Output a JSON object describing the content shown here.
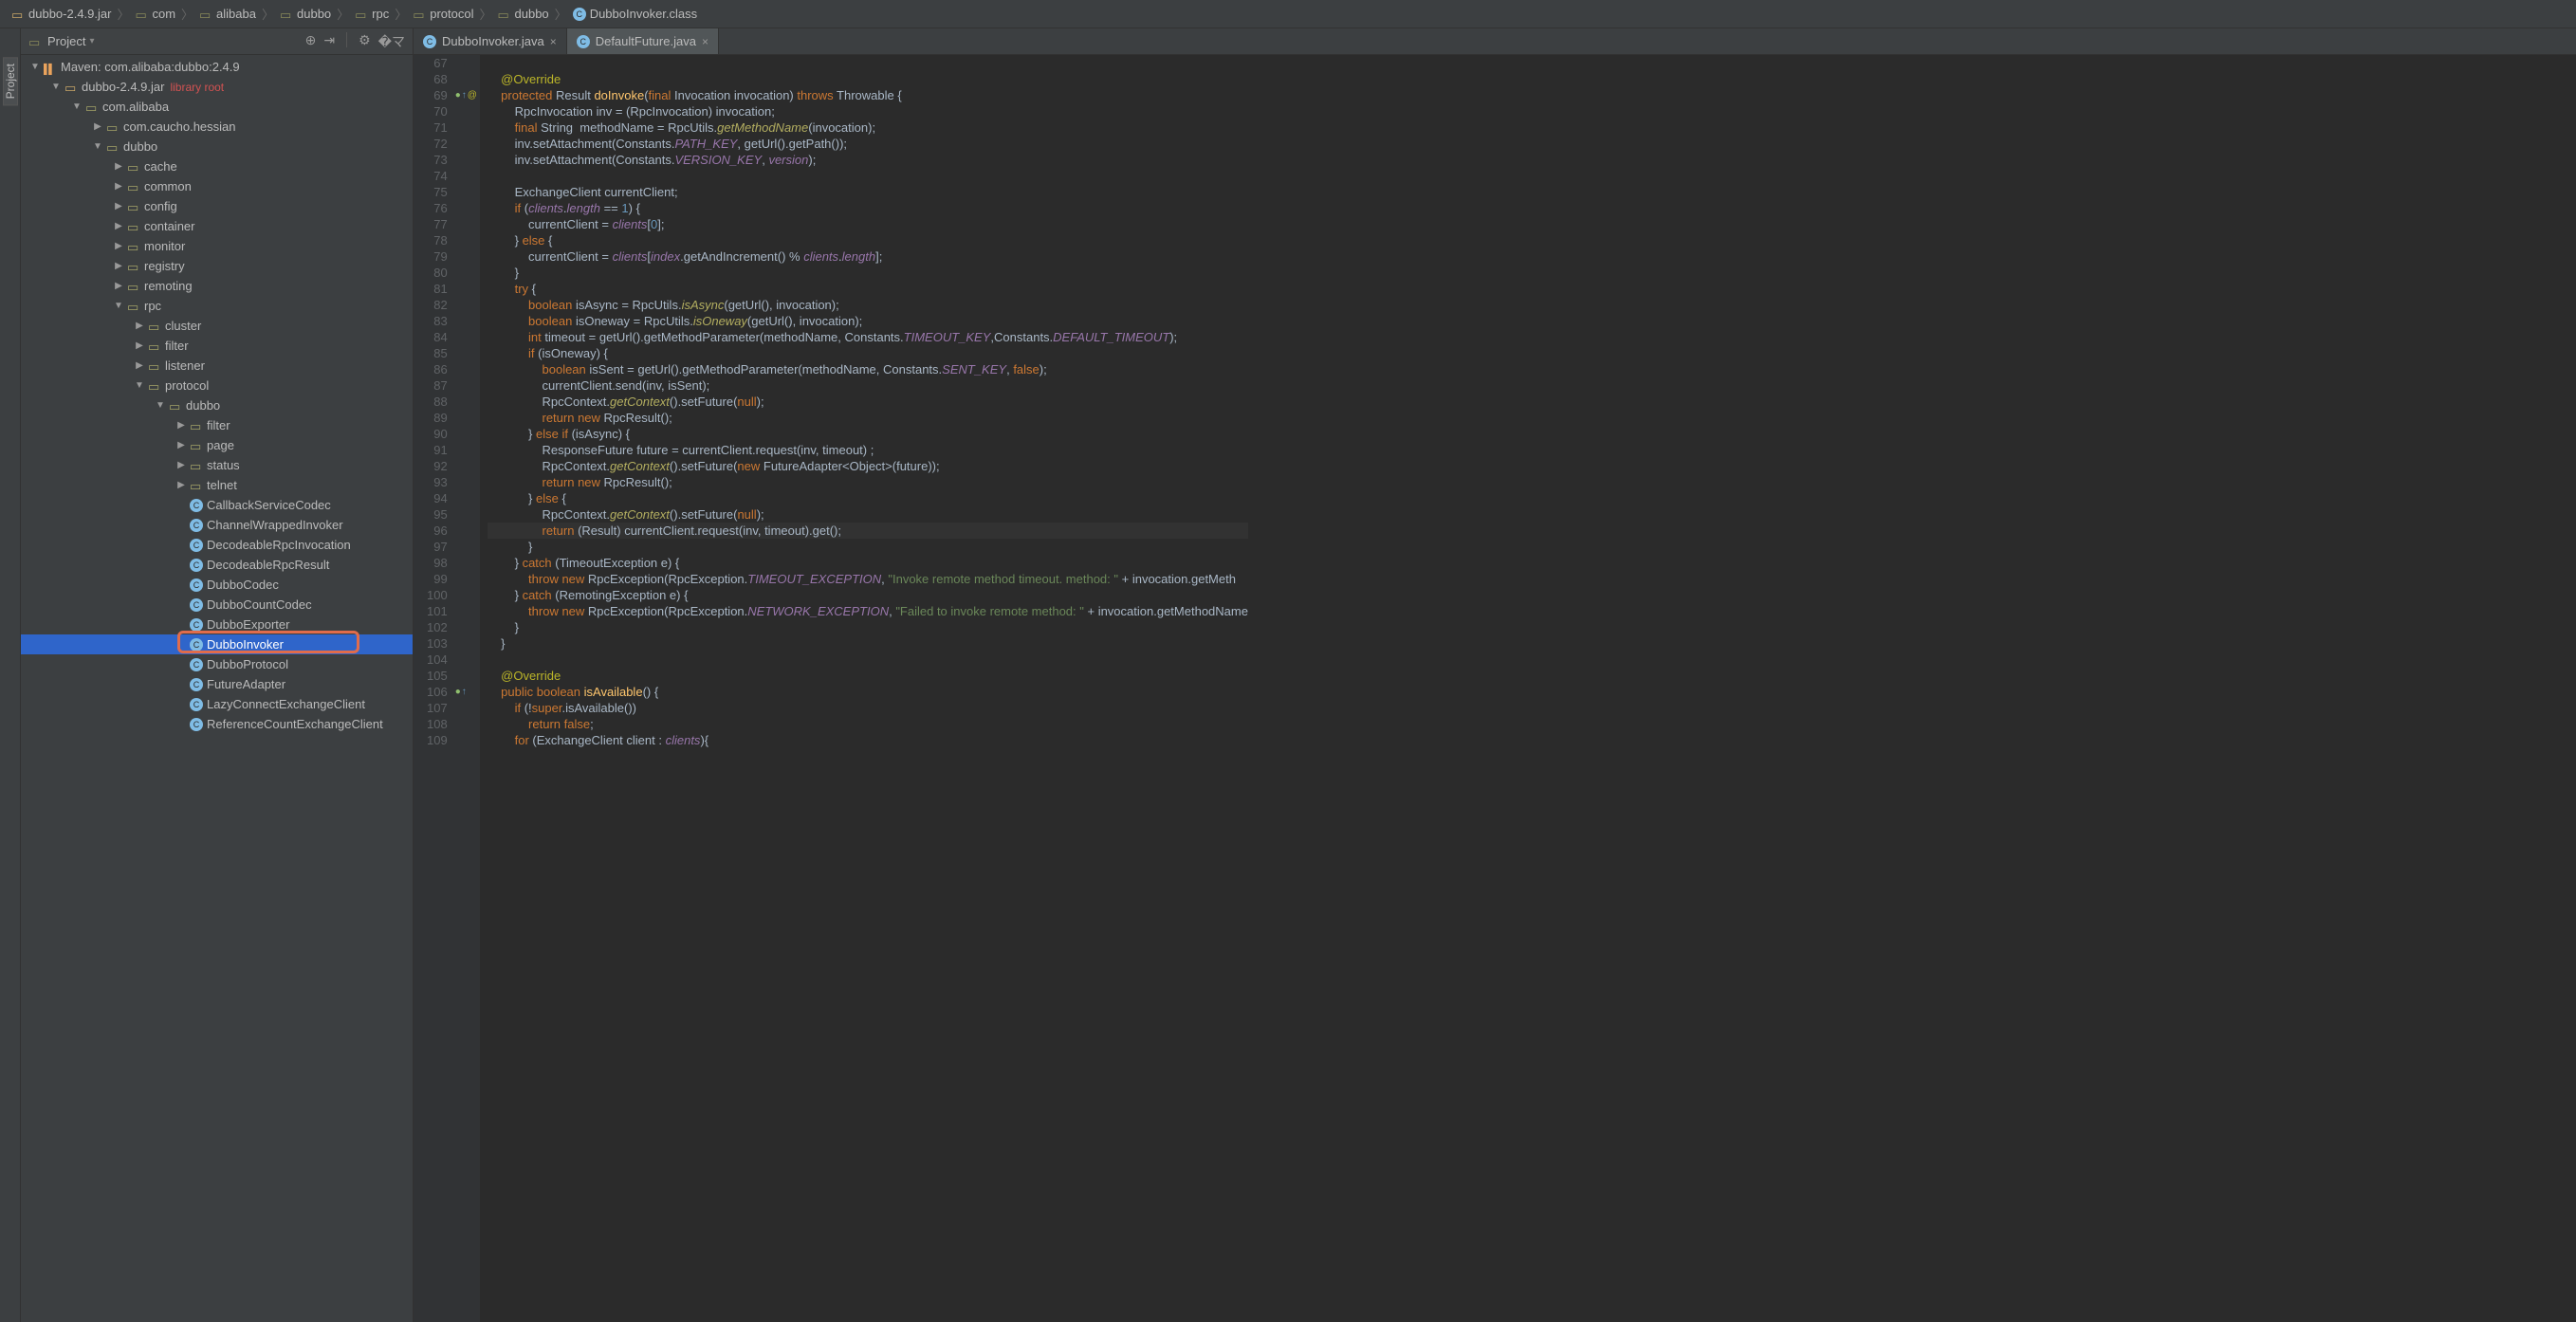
{
  "breadcrumb": [
    {
      "icon": "jar",
      "label": "dubbo-2.4.9.jar"
    },
    {
      "icon": "folder",
      "label": "com"
    },
    {
      "icon": "folder",
      "label": "alibaba"
    },
    {
      "icon": "folder",
      "label": "dubbo"
    },
    {
      "icon": "folder",
      "label": "rpc"
    },
    {
      "icon": "folder",
      "label": "protocol"
    },
    {
      "icon": "folder",
      "label": "dubbo"
    },
    {
      "icon": "class",
      "label": "DubboInvoker.class"
    }
  ],
  "panel": {
    "title": "Project"
  },
  "maven_line": "Maven: com.alibaba:dubbo:2.4.9",
  "tree": [
    {
      "indent": 0,
      "arrow": "down",
      "icon": "book",
      "label": "Maven: com.alibaba:dubbo:2.4.9"
    },
    {
      "indent": 1,
      "arrow": "down",
      "icon": "jar",
      "label": "dubbo-2.4.9.jar",
      "note": "library root"
    },
    {
      "indent": 2,
      "arrow": "down",
      "icon": "pkg",
      "label": "com.alibaba"
    },
    {
      "indent": 3,
      "arrow": "right",
      "icon": "pkg",
      "label": "com.caucho.hessian"
    },
    {
      "indent": 3,
      "arrow": "down",
      "icon": "pkg",
      "label": "dubbo"
    },
    {
      "indent": 4,
      "arrow": "right",
      "icon": "pkg",
      "label": "cache"
    },
    {
      "indent": 4,
      "arrow": "right",
      "icon": "pkg",
      "label": "common"
    },
    {
      "indent": 4,
      "arrow": "right",
      "icon": "pkg",
      "label": "config"
    },
    {
      "indent": 4,
      "arrow": "right",
      "icon": "pkg",
      "label": "container"
    },
    {
      "indent": 4,
      "arrow": "right",
      "icon": "pkg",
      "label": "monitor"
    },
    {
      "indent": 4,
      "arrow": "right",
      "icon": "pkg",
      "label": "registry"
    },
    {
      "indent": 4,
      "arrow": "right",
      "icon": "pkg",
      "label": "remoting"
    },
    {
      "indent": 4,
      "arrow": "down",
      "icon": "pkg",
      "label": "rpc"
    },
    {
      "indent": 5,
      "arrow": "right",
      "icon": "pkg",
      "label": "cluster"
    },
    {
      "indent": 5,
      "arrow": "right",
      "icon": "pkg",
      "label": "filter"
    },
    {
      "indent": 5,
      "arrow": "right",
      "icon": "pkg",
      "label": "listener"
    },
    {
      "indent": 5,
      "arrow": "down",
      "icon": "pkg",
      "label": "protocol"
    },
    {
      "indent": 6,
      "arrow": "down",
      "icon": "pkg",
      "label": "dubbo"
    },
    {
      "indent": 7,
      "arrow": "right",
      "icon": "pkg",
      "label": "filter"
    },
    {
      "indent": 7,
      "arrow": "right",
      "icon": "pkg",
      "label": "page"
    },
    {
      "indent": 7,
      "arrow": "right",
      "icon": "pkg",
      "label": "status"
    },
    {
      "indent": 7,
      "arrow": "right",
      "icon": "pkg",
      "label": "telnet"
    },
    {
      "indent": 7,
      "arrow": "",
      "icon": "class",
      "label": "CallbackServiceCodec"
    },
    {
      "indent": 7,
      "arrow": "",
      "icon": "class",
      "label": "ChannelWrappedInvoker"
    },
    {
      "indent": 7,
      "arrow": "",
      "icon": "class",
      "label": "DecodeableRpcInvocation"
    },
    {
      "indent": 7,
      "arrow": "",
      "icon": "class",
      "label": "DecodeableRpcResult"
    },
    {
      "indent": 7,
      "arrow": "",
      "icon": "class",
      "label": "DubboCodec"
    },
    {
      "indent": 7,
      "arrow": "",
      "icon": "class",
      "label": "DubboCountCodec"
    },
    {
      "indent": 7,
      "arrow": "",
      "icon": "class",
      "label": "DubboExporter"
    },
    {
      "indent": 7,
      "arrow": "",
      "icon": "class",
      "label": "DubboInvoker",
      "selected": true
    },
    {
      "indent": 7,
      "arrow": "",
      "icon": "class",
      "label": "DubboProtocol"
    },
    {
      "indent": 7,
      "arrow": "",
      "icon": "class",
      "label": "FutureAdapter"
    },
    {
      "indent": 7,
      "arrow": "",
      "icon": "class",
      "label": "LazyConnectExchangeClient"
    },
    {
      "indent": 7,
      "arrow": "",
      "icon": "class",
      "label": "ReferenceCountExchangeClient"
    }
  ],
  "tabs": [
    {
      "icon": "class",
      "label": "DubboInvoker.java",
      "active": true
    },
    {
      "icon": "class",
      "label": "DefaultFuture.java",
      "active": false
    }
  ],
  "gutter_marks": {
    "69": "o↑ @",
    "106": "o↑"
  },
  "code_start": 67,
  "highlighted_line": 96,
  "code": [
    "",
    "    <a>@Override</a>",
    "    <k>protected</k> Result <m>doInvoke</m>(<k>final</k> Invocation invocation) <k>throws</k> Throwable {",
    "        RpcInvocation inv = (RpcInvocation) invocation;",
    "        <k>final</k> String  methodName = RpcUtils.<mi>getMethodName</mi>(invocation);",
    "        inv.setAttachment(Constants.<ci>PATH_KEY</ci>, getUrl().getPath());",
    "        inv.setAttachment(Constants.<ci>VERSION_KEY</ci>, <fi>version</fi>);",
    "        ",
    "        ExchangeClient currentClient;",
    "        <k>if</k> (<fi>clients</fi>.<fi>length</fi> == <n>1</n>) {",
    "            currentClient = <fi>clients</fi>[<n>0</n>];",
    "        } <k>else</k> {",
    "            currentClient = <fi>clients</fi>[<fi>index</fi>.getAndIncrement() % <fi>clients</fi>.<fi>length</fi>];",
    "        }",
    "        <k>try</k> {",
    "            <k>boolean</k> isAsync = RpcUtils.<mi>isAsync</mi>(getUrl(), invocation);",
    "            <k>boolean</k> isOneway = RpcUtils.<mi>isOneway</mi>(getUrl(), invocation);",
    "            <k>int</k> timeout = getUrl().getMethodParameter(methodName, Constants.<ci>TIMEOUT_KEY</ci>,Constants.<ci>DEFAULT_TIMEOUT</ci>);",
    "            <k>if</k> (isOneway) {",
    "            \t<k>boolean</k> isSent = getUrl().getMethodParameter(methodName, Constants.<ci>SENT_KEY</ci>, <k>false</k>);",
    "                currentClient.send(inv, isSent);",
    "                RpcContext.<mi>getContext</mi>().setFuture(<k>null</k>);",
    "                <k>return new</k> RpcResult();",
    "            } <k>else if</k> (isAsync) {",
    "            \tResponseFuture future = currentClient.request(inv, timeout) ;",
    "                RpcContext.<mi>getContext</mi>().setFuture(<k>new</k> FutureAdapter&lt;Object&gt;(future));",
    "                <k>return new</k> RpcResult();",
    "            } <k>else</k> {",
    "            \tRpcContext.<mi>getContext</mi>().setFuture(<k>null</k>);",
    "                <k>return</k> (Result) currentClient.request(inv, timeout).get();",
    "            }",
    "        } <k>catch</k> (TimeoutException e) {",
    "            <k>throw new</k> RpcException(RpcException.<ci>TIMEOUT_EXCEPTION</ci>, <s>\"Invoke remote method timeout. method: \"</s> + invocation.getMeth",
    "        } <k>catch</k> (RemotingException e) {",
    "            <k>throw new</k> RpcException(RpcException.<ci>NETWORK_EXCEPTION</ci>, <s>\"Failed to invoke remote method: \"</s> + invocation.getMethodName",
    "        }",
    "    }",
    "",
    "    <a>@Override</a>",
    "    <k>public boolean</k> <m>isAvailable</m>() {",
    "        <k>if</k> (!<k>super</k>.isAvailable())",
    "            <k>return false</k>;",
    "        <k>for</k> (ExchangeClient client : <fi>clients</fi>){"
  ]
}
